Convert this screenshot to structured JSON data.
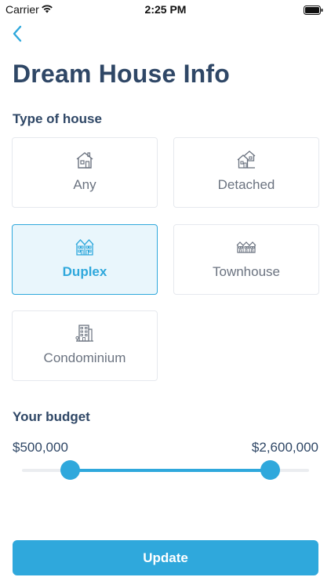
{
  "status_bar": {
    "carrier": "Carrier",
    "time": "2:25 PM"
  },
  "page": {
    "title": "Dream House Info"
  },
  "house_type": {
    "label": "Type of house",
    "options": [
      {
        "label": "Any",
        "icon": "house-icon",
        "selected": false
      },
      {
        "label": "Detached",
        "icon": "detached-house-icon",
        "selected": false
      },
      {
        "label": "Duplex",
        "icon": "duplex-icon",
        "selected": true
      },
      {
        "label": "Townhouse",
        "icon": "townhouse-icon",
        "selected": false
      },
      {
        "label": "Condominium",
        "icon": "condominium-icon",
        "selected": false
      }
    ]
  },
  "budget": {
    "label": "Your budget",
    "min_label": "$500,000",
    "max_label": "$2,600,000",
    "slider_low_fraction": 0.167,
    "slider_high_fraction": 0.866
  },
  "actions": {
    "update_label": "Update"
  },
  "colors": {
    "accent": "#2fa8dc",
    "title": "#2f4766",
    "selected_bg": "#e9f6fc"
  }
}
